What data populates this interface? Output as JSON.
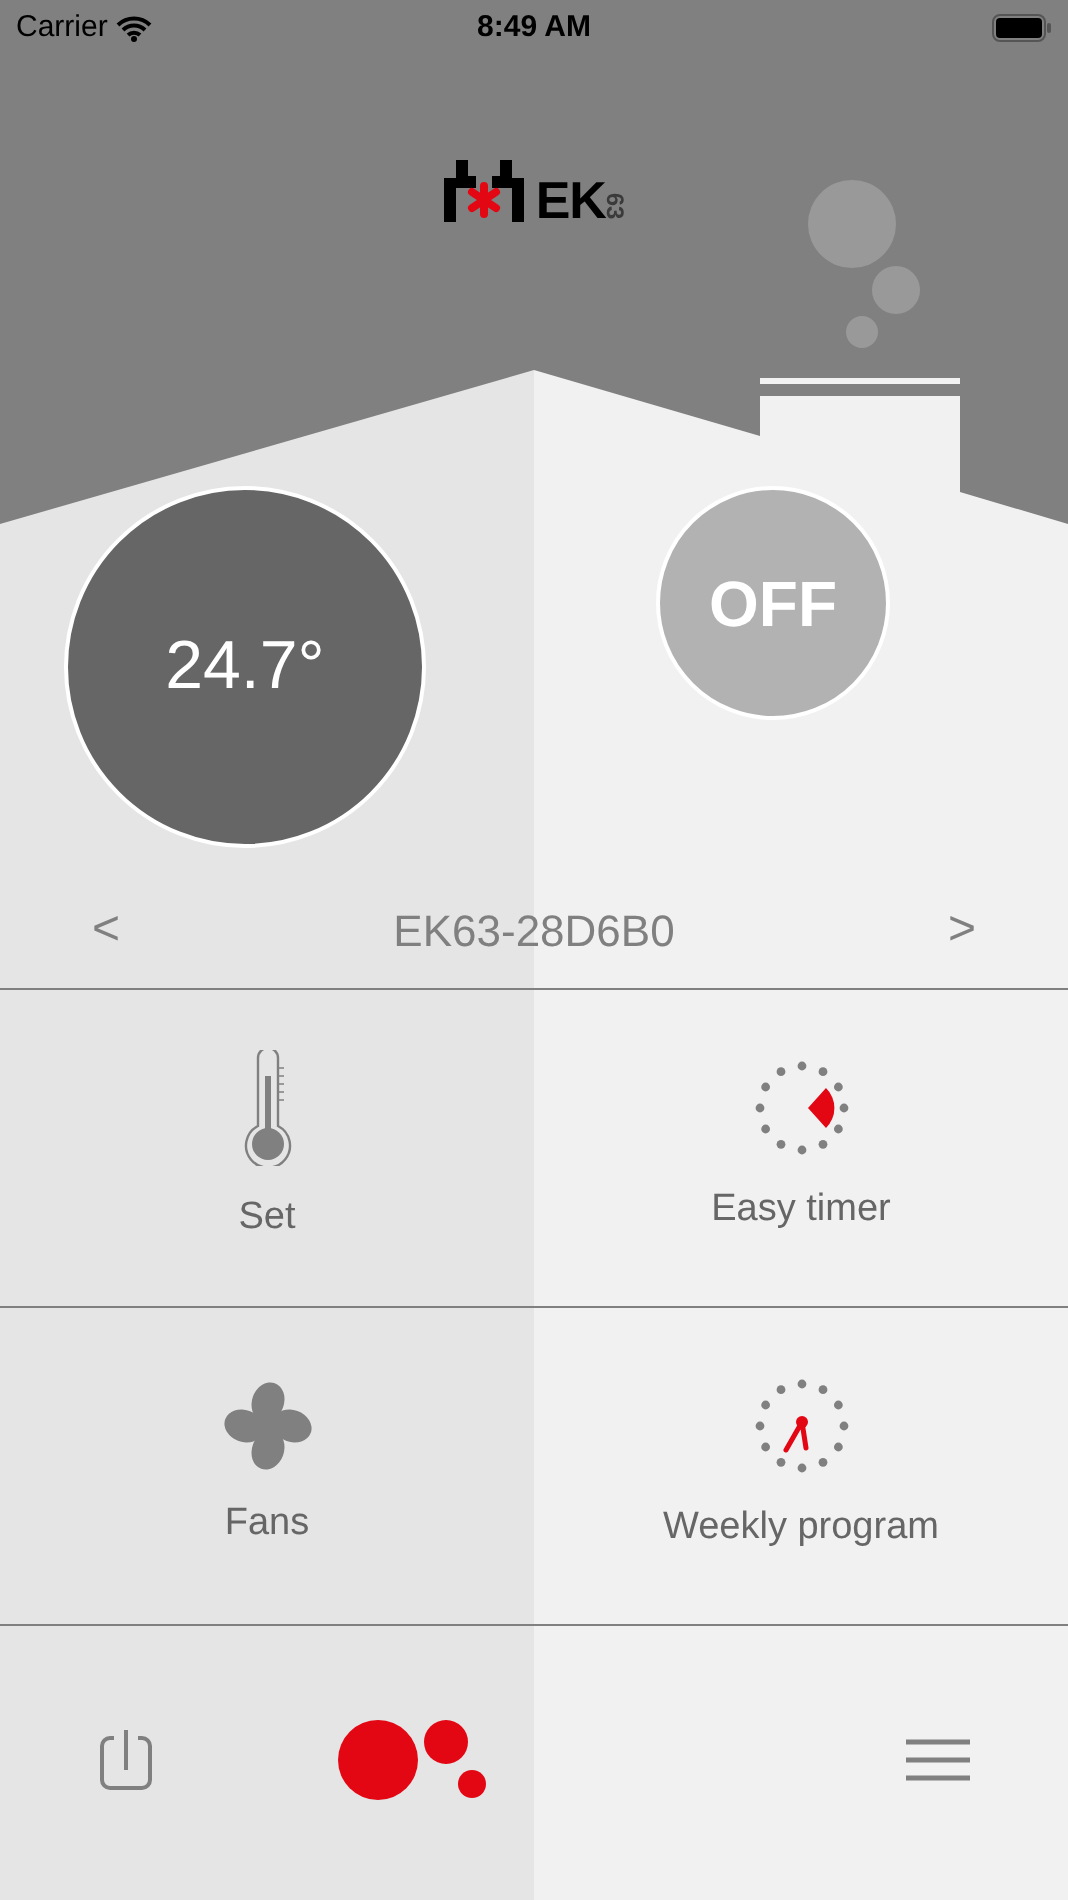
{
  "status_bar": {
    "carrier": "Carrier",
    "time": "8:49 AM"
  },
  "logo": {
    "name": "EK",
    "number": "63"
  },
  "temperature": "24.7°",
  "power": {
    "label": "OFF",
    "on": false
  },
  "device": {
    "prev": "<",
    "name": "EK63-28D6B0",
    "next": ">"
  },
  "menu": [
    {
      "kind": "thermometer",
      "label": "Set"
    },
    {
      "kind": "timer",
      "label": "Easy timer"
    },
    {
      "kind": "fan",
      "label": "Fans"
    },
    {
      "kind": "clock",
      "label": "Weekly program"
    }
  ]
}
